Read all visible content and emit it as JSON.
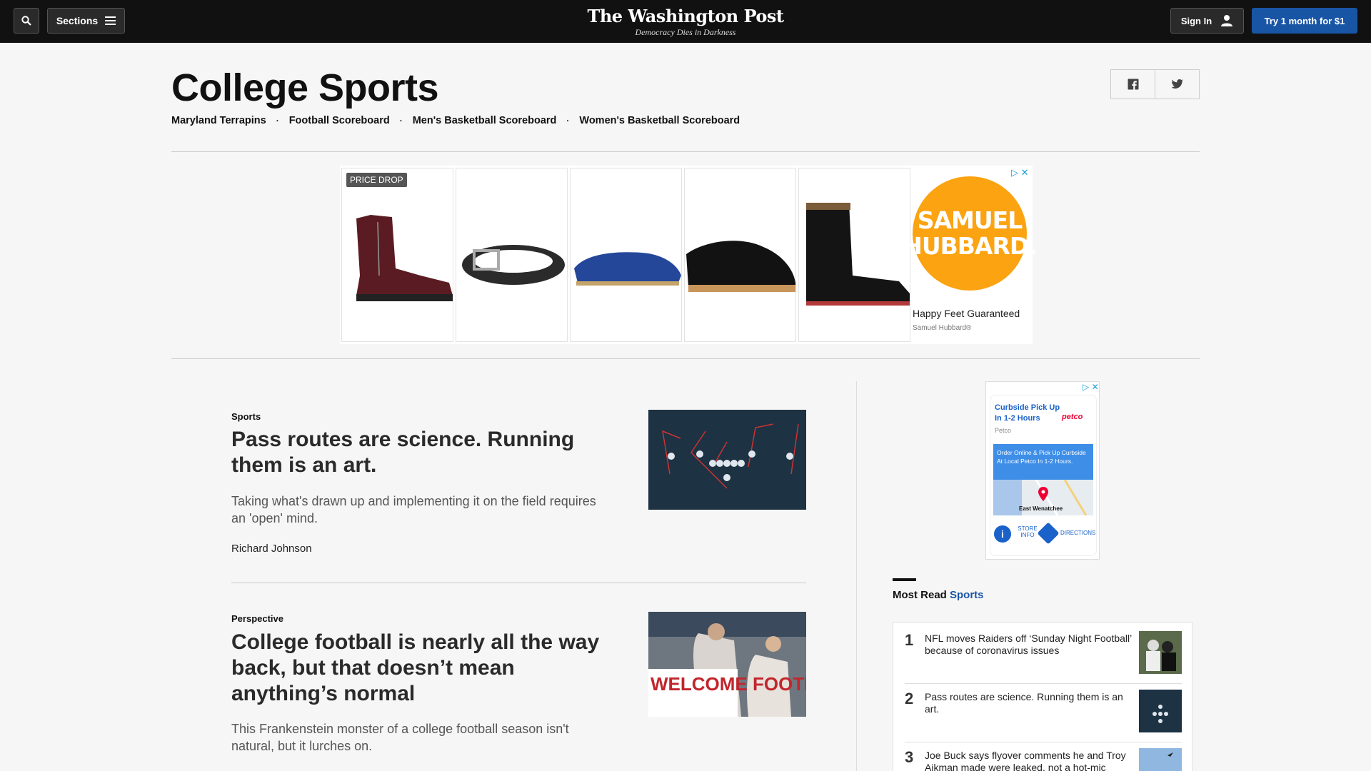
{
  "topbar": {
    "sections_label": "Sections",
    "logo": "The Washington Post",
    "tagline": "Democracy Dies in Darkness",
    "signin_label": "Sign In",
    "subscribe_label": "Try 1 month for $1"
  },
  "section": {
    "title": "College Sports",
    "subnav": [
      "Maryland Terrapins",
      "Football Scoreboard",
      "Men's Basketball Scoreboard",
      "Women's Basketball Scoreboard"
    ],
    "dot": "·"
  },
  "ad": {
    "badge": "PRICE DROP",
    "brand": "SAMUEL HUBBARD.",
    "tagline": "Happy Feet Guaranteed",
    "sub": "Samuel Hubbard®"
  },
  "articles": [
    {
      "kicker": "Sports",
      "headline": "Pass routes are science. Running them is an art.",
      "dek": "Taking what's drawn up and implementing it on the field requires an 'open' mind.",
      "byline": "Richard Johnson"
    },
    {
      "kicker": "Perspective",
      "headline": "College football is nearly all the way back, but that doesn’t mean anything’s normal",
      "dek": "This Frankenstein monster of a college football season isn't natural, but it lurches on.",
      "thumb_text": "WELCOME FOOTBALL"
    }
  ],
  "rail_ad": {
    "title": "Curbside Pick Up In 1-2 Hours",
    "brand": "petco",
    "sub": "Petco",
    "body": "Order Online & Pick Up Curbside At Local Petco In 1-2 Hours.",
    "map_label": "East Wenatchee",
    "store_info": "STORE INFO",
    "directions": "DIRECTIONS"
  },
  "most_read": {
    "prefix": "Most Read",
    "section": "Sports",
    "items": [
      {
        "num": "1",
        "text": "NFL moves Raiders off ‘Sunday Night Football’ because of coronavirus issues"
      },
      {
        "num": "2",
        "text": "Pass routes are science. Running them is an art."
      },
      {
        "num": "3",
        "text": "Joe Buck says flyover comments he and Troy Aikman made were leaked, not a hot-mic"
      }
    ]
  },
  "colors": {
    "accent": "#1955a5",
    "topbar": "#111111",
    "ad_orange": "#fca311"
  }
}
